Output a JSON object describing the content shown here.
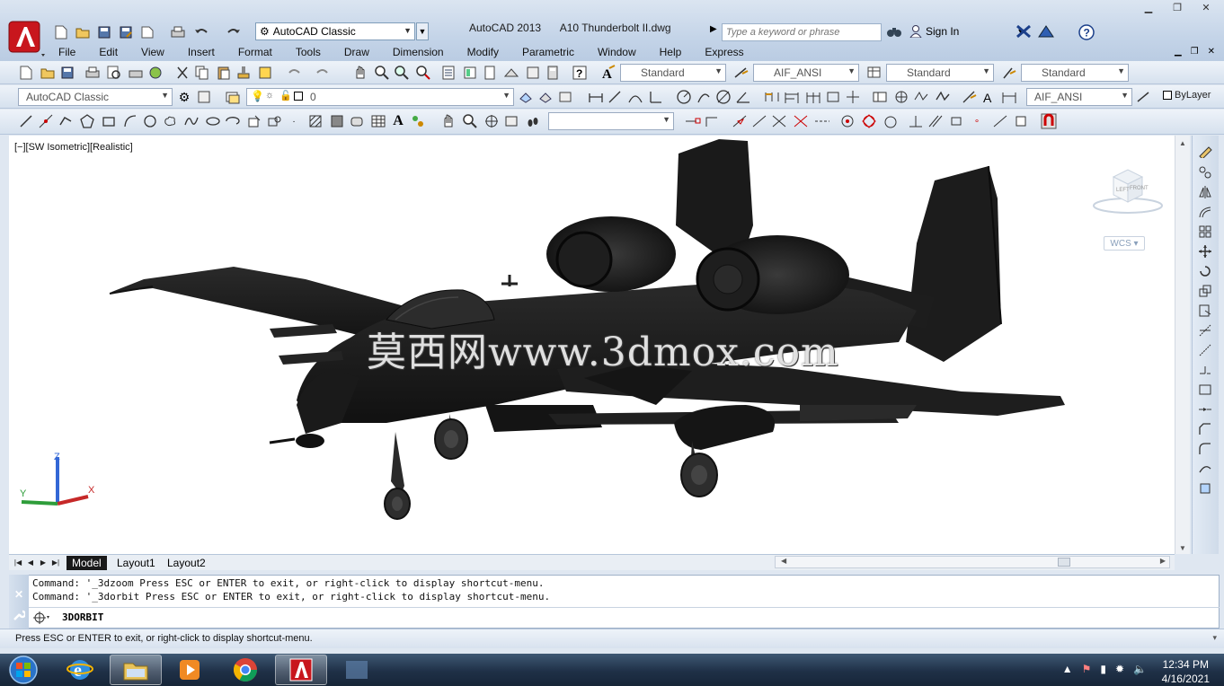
{
  "app": {
    "workspace": "AutoCAD Classic",
    "product": "AutoCAD 2013",
    "file": "A10 Thunderbolt II.dwg",
    "search_placeholder": "Type a keyword or phrase",
    "sign_in": "Sign In"
  },
  "menu": [
    "File",
    "Edit",
    "View",
    "Insert",
    "Format",
    "Tools",
    "Draw",
    "Dimension",
    "Modify",
    "Parametric",
    "Window",
    "Help",
    "Express"
  ],
  "styles_toolbar": {
    "text_style": "Standard",
    "dim_style": "AIF_ANSI",
    "table_style": "Standard",
    "mleader_style": "Standard"
  },
  "layers_toolbar": {
    "workspace": "AutoCAD Classic",
    "layer": "0",
    "dim_style": "AIF_ANSI",
    "color": "ByLayer"
  },
  "viewport": {
    "label": "[−][SW Isometric][Realistic]",
    "watermark": "莫西网www.3dmox.com",
    "viewcube_left": "LEFT",
    "viewcube_front": "FRONT",
    "wcs": "WCS",
    "axis_x": "X",
    "axis_y": "Y",
    "axis_z": "Z"
  },
  "tabs": [
    "Model",
    "Layout1",
    "Layout2"
  ],
  "command": {
    "history": [
      "Command: '_3dzoom Press ESC or ENTER to exit, or right-click to display shortcut-menu.",
      "Command: '_3dorbit Press ESC or ENTER to exit, or right-click to display shortcut-menu."
    ],
    "current": "3DORBIT"
  },
  "status": "Press ESC or ENTER to exit, or right-click to display shortcut-menu.",
  "taskbar": {
    "time": "12:34 PM",
    "date": "4/16/2021"
  },
  "colors": {
    "autocad_red": "#c8161d",
    "titlebar": "#c4d4e8",
    "taskbar": "#1f3047",
    "aircraft": "#1c1c1c"
  }
}
